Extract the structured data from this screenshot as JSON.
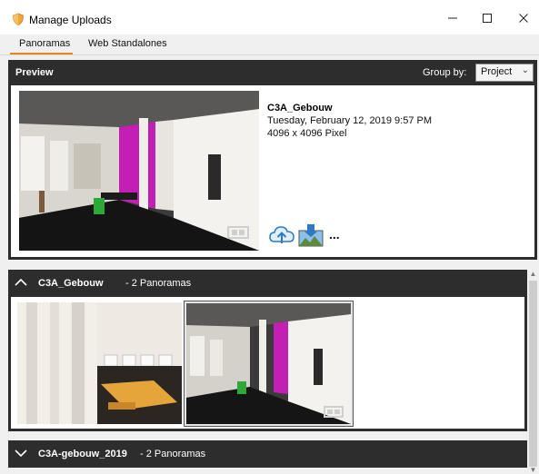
{
  "window": {
    "title": "Manage Uploads",
    "icon": "shield-icon",
    "controls": {
      "minimize": "—",
      "maximize": "☐",
      "close": "✕"
    }
  },
  "tabs": [
    {
      "label": "Panoramas",
      "active": true
    },
    {
      "label": "Web Standalones",
      "active": false
    }
  ],
  "preview": {
    "header": "Preview",
    "group_by_label": "Group by:",
    "group_by_value": "Project",
    "item": {
      "name": "C3A_Gebouw",
      "date": "Tuesday, February 12, 2019 9:57 PM",
      "size": "4096 x 4096 Pixel"
    },
    "actions": {
      "more": "..."
    }
  },
  "groups": [
    {
      "name": "C3A_Gebouw",
      "count": " - 2 Panoramas",
      "expanded": true
    },
    {
      "name": "C3A-gebouw_2019",
      "count": " - 2 Panoramas",
      "expanded": false
    }
  ],
  "colors": {
    "accent": "#e08a1e",
    "header_bg": "#2d2d2d",
    "magenta": "#c41fb5"
  }
}
